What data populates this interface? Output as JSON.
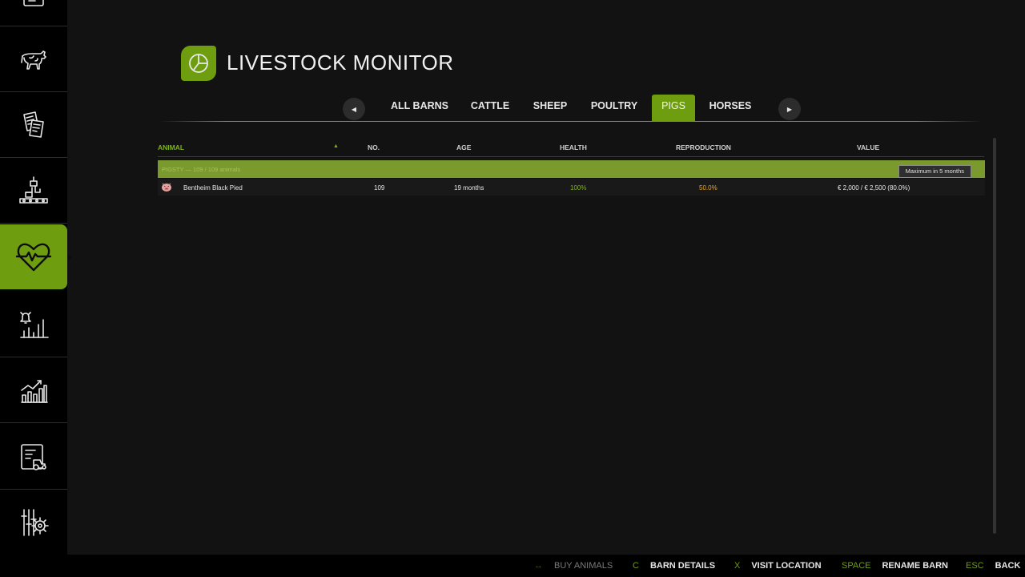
{
  "header": {
    "title": "LIVESTOCK MONITOR"
  },
  "tabs": [
    {
      "label": "ALL BARNS",
      "active": false
    },
    {
      "label": "CATTLE",
      "active": false
    },
    {
      "label": "SHEEP",
      "active": false
    },
    {
      "label": "POULTRY",
      "active": false
    },
    {
      "label": "PIGS",
      "active": true
    },
    {
      "label": "HORSES",
      "active": false
    }
  ],
  "table": {
    "columns": [
      "ANIMAL",
      "NO.",
      "AGE",
      "HEALTH",
      "REPRODUCTION",
      "VALUE"
    ],
    "group": {
      "label": "PIGSTY — 109 / 109 animals",
      "badge": "Maximum in 5 months"
    },
    "rows": [
      {
        "animal": "Bentheim Black Pied",
        "number": "109",
        "age": "19 months",
        "health": "100%",
        "reproduction": "50.0%",
        "value": "€ 2,000 / € 2,500 (80.0%)"
      }
    ]
  },
  "bottom_bar": [
    {
      "key": "↔",
      "label": "BUY ANIMALS",
      "enabled": false
    },
    {
      "key": "C",
      "label": "BARN DETAILS",
      "enabled": true
    },
    {
      "key": "X",
      "label": "VISIT LOCATION",
      "enabled": true
    },
    {
      "key": "SPACE",
      "label": "RENAME BARN",
      "enabled": true
    },
    {
      "key": "ESC",
      "label": "BACK",
      "enabled": true
    }
  ],
  "sidebar": {
    "icons": [
      "map-icon",
      "cow-icon",
      "contracts-icon",
      "production-icon",
      "animal-health-icon",
      "price-alert-icon",
      "statistics-icon",
      "vehicles-icon",
      "settings-icon"
    ],
    "active_index": 4
  },
  "colors": {
    "accent": "#6e9e10",
    "group_row": "#7a9a2e",
    "health": "#7fb11c",
    "reproduction": "#e8a324"
  }
}
